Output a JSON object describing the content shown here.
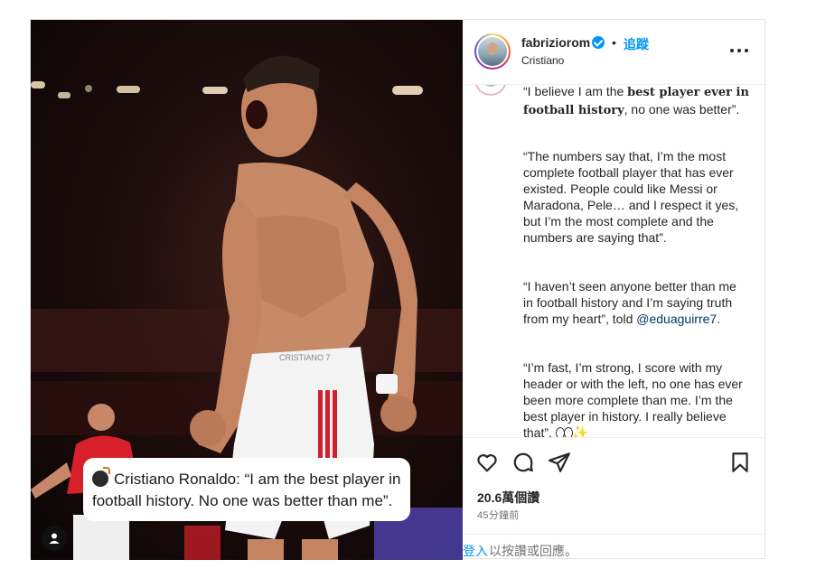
{
  "header": {
    "username": "fabriziorom",
    "verified": true,
    "dot": "•",
    "follow_label": "追蹤",
    "subtitle": "Cristiano"
  },
  "media": {
    "overlay_text": "Cristiano Ronaldo: “I am the best player in football history. No one was better than me”.",
    "overlay_emoji": "bomb-icon",
    "user_tag_icon": "user-icon",
    "shirt_text": "CRISTIANO 7"
  },
  "caption": {
    "p1_a": "“I believe I am the ",
    "p1_bold": "best player ever in football history",
    "p1_b": ", no one was better”.",
    "p2": "“The numbers say that, I’m the most complete football player that has ever existed. People could like Messi or Maradona, Pele… and I respect it yes, but I’m the most complete and the numbers are saying that”.",
    "p3_a": "“I haven’t seen anyone better than me in football history and I’m saying truth from my heart”, told ",
    "p3_mention": "@eduaguirre7",
    "p3_b": ".",
    "p4": "“I’m fast, I’m strong, I score with my header or with the left, no one has ever been more complete than me. I’m the best player in history. I really believe that”. "
  },
  "actions": {
    "like_icon": "heart-icon",
    "comment_icon": "comment-icon",
    "share_icon": "send-icon",
    "save_icon": "bookmark-icon",
    "likes": "20.6萬個讚",
    "time": "45分鐘前"
  },
  "login": {
    "link": "登入",
    "rest": "以按讚或回應。"
  },
  "colors": {
    "accent": "#0095f6",
    "text": "#262626",
    "muted": "#737373",
    "mention": "#00376b"
  }
}
